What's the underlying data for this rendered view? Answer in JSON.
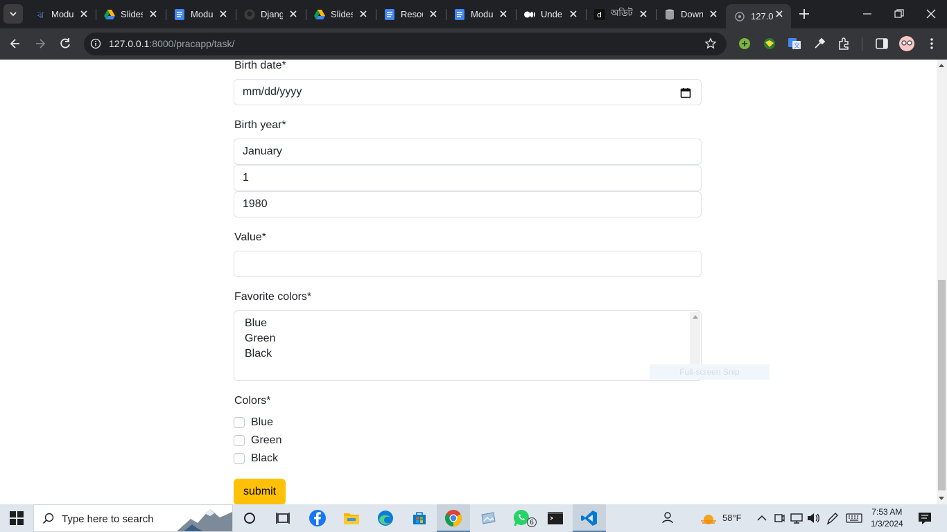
{
  "browser": {
    "tabs": [
      {
        "title": "Modu",
        "icon": "hash-icon"
      },
      {
        "title": "Slides",
        "icon": "google-drive-icon"
      },
      {
        "title": "Modu",
        "icon": "google-docs-icon"
      },
      {
        "title": "Djang",
        "icon": "github-icon"
      },
      {
        "title": "Slides",
        "icon": "google-drive-icon"
      },
      {
        "title": "Resou",
        "icon": "google-docs-icon"
      },
      {
        "title": "Modu",
        "icon": "google-docs-icon"
      },
      {
        "title": "Unde",
        "icon": "medium-icon"
      },
      {
        "title": "অডিট",
        "icon": "d-letter-icon"
      },
      {
        "title": "Down",
        "icon": "database-icon"
      },
      {
        "title": "127.0",
        "icon": "globe-icon",
        "active": true
      }
    ],
    "url_host": "127.0.0.1",
    "url_path": ":8000/pracapp/task/"
  },
  "form": {
    "birth_date_label": "Birth date*",
    "birth_date_placeholder": "mm/dd/yyyy",
    "birth_year_label": "Birth year*",
    "birth_year_month": "January",
    "birth_year_day": "1",
    "birth_year_year": "1980",
    "value_label": "Value*",
    "value_input": "",
    "favorite_colors_label": "Favorite colors*",
    "favorite_colors_options": [
      "Blue",
      "Green",
      "Black"
    ],
    "colors_label": "Colors*",
    "colors_checkboxes": [
      {
        "label": "Blue",
        "checked": false
      },
      {
        "label": "Green",
        "checked": false
      },
      {
        "label": "Black",
        "checked": false
      }
    ],
    "submit_label": "submit",
    "snip_hint": "Full-screen Snip"
  },
  "taskbar": {
    "search_placeholder": "Type here to search",
    "whatsapp_badge": "6",
    "temperature": "58°F",
    "time": "7:53 AM",
    "date": "1/3/2024"
  },
  "colors": {
    "chrome_dark": "#202124",
    "chrome_toolbar": "#35363a",
    "submit_yellow": "#ffc107",
    "taskbar": "#dfe6ee"
  }
}
